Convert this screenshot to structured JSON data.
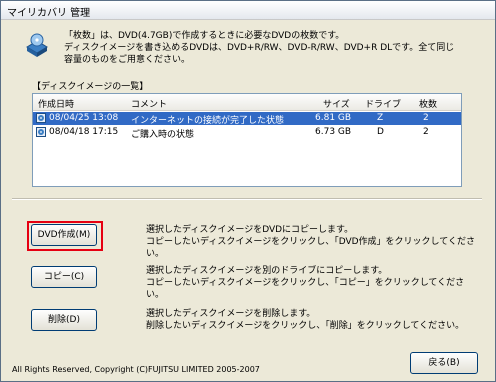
{
  "window": {
    "title": "マイリカバリ 管理"
  },
  "description": {
    "line1": "「枚数」は、DVD(4.7GB)で作成するときに必要なDVDの枚数です。",
    "line2": "ディスクイメージを書き込めるDVDは、DVD+R/RW、DVD-R/RW、DVD+R DLです。全て同じ",
    "line3": "容量のものをご用意ください。"
  },
  "disk_list": {
    "label": "【ディスクイメージの一覧】",
    "columns": [
      "作成日時",
      "コメント",
      "サイズ",
      "ドライブ",
      "枚数"
    ],
    "rows": [
      {
        "date": "08/04/25 13:08",
        "comment": "インターネットの接続が完了した状態",
        "size": "6.81 GB",
        "drive": "Z",
        "count": "2",
        "selected": true
      },
      {
        "date": "08/04/18 17:15",
        "comment": "ご購入時の状態",
        "size": "6.73 GB",
        "drive": "D",
        "count": "2",
        "selected": false
      }
    ]
  },
  "actions": {
    "create": {
      "label": "DVD作成(M)",
      "line1": "選択したディスクイメージをDVDにコピーします。",
      "line2": "コピーしたいディスクイメージをクリックし、「DVD作成」をクリックしてください。"
    },
    "copy": {
      "label": "コピー(C)",
      "line1": "選択したディスクイメージを別のドライブにコピーします。",
      "line2": "コピーしたいディスクイメージをクリックし、「コピー」をクリックしてください。"
    },
    "delete": {
      "label": "削除(D)",
      "line1": "選択したディスクイメージを削除します。",
      "line2": "削除したいディスクイメージをクリックし、「削除」をクリックしてください。"
    }
  },
  "footer": {
    "copyright": "All Rights Reserved, Copyright (C)FUJITSU LIMITED 2005-2007",
    "back_label": "戻る(B)"
  },
  "colors": {
    "highlight": "#e60012",
    "selection": "#316ac5"
  },
  "icons": {
    "app": "recovery-disc-icon",
    "disc": "disc-image-icon"
  }
}
